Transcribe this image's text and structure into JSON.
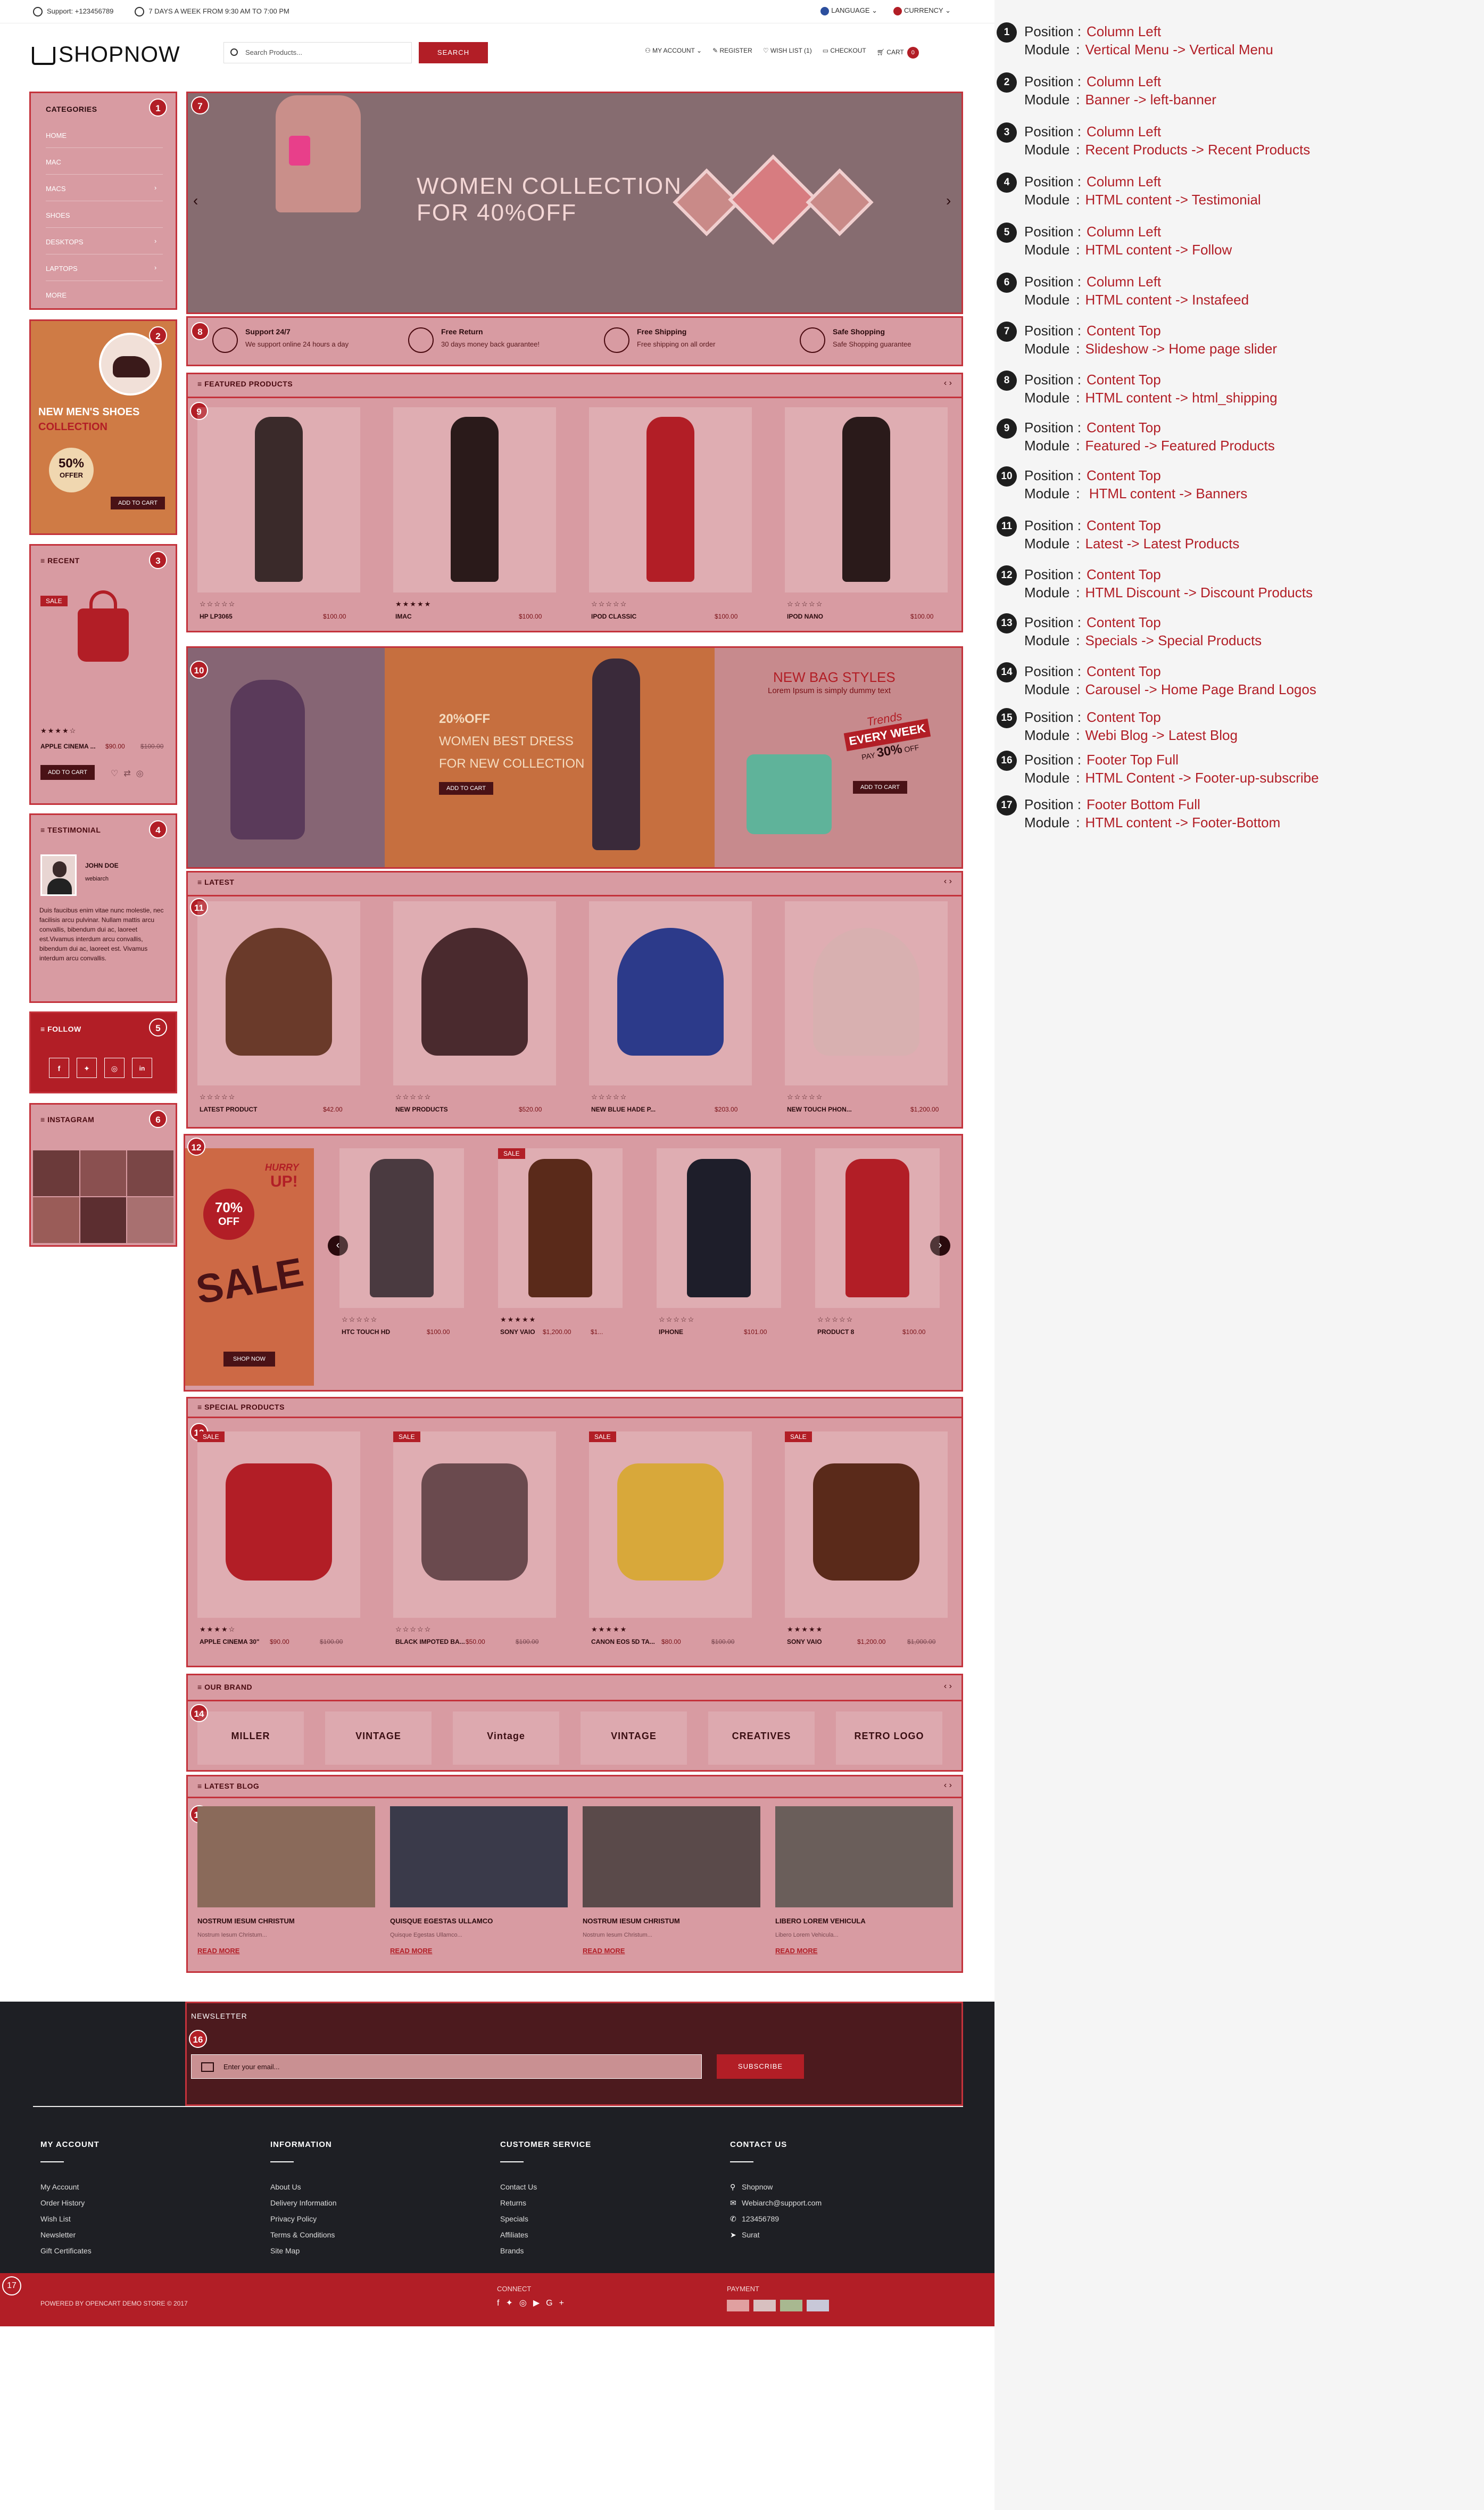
{
  "topbar": {
    "support": "Support: +123456789",
    "hours": "7 DAYS A WEEK FROM 9:30 AM TO 7:00 PM",
    "language": "LANGUAGE",
    "currency": "CURRENCY"
  },
  "header": {
    "logo": "SHOPNOW",
    "search_placeholder": "Search Products...",
    "search_button": "SEARCH",
    "my_account": "MY ACCOUNT",
    "register": "REGISTER",
    "wishlist": "WISH LIST (1)",
    "checkout": "CHECKOUT",
    "cart": "CART",
    "cart_count": "0"
  },
  "sidebar": {
    "categories_title": "CATEGORIES",
    "categories": [
      "HOME",
      "MAC",
      "MACS",
      "SHOES",
      "DESKTOPS",
      "LAPTOPS",
      "MORE"
    ],
    "banner": {
      "title": "NEW MEN'S SHOES",
      "subtitle": "COLLECTION",
      "offer": "50%",
      "offer_sub": "OFFER",
      "button": "ADD TO CART"
    },
    "recent": {
      "title": "RECENT",
      "sale": "SALE",
      "name": "APPLE CINEMA ...",
      "price": "$90.00",
      "old": "$100.00",
      "button": "ADD TO CART"
    },
    "testimonial": {
      "title": "TESTIMONIAL",
      "name": "JOHN DOE",
      "handle": "webiarch",
      "text": "Duis faucibus enim vitae nunc molestie, nec facilisis arcu pulvinar. Nullam mattis arcu convallis, bibendum dui ac, laoreet est.Vivamus interdum arcu convallis, bibendum dui ac, laoreet est. Vivamus interdum arcu convallis."
    },
    "follow": {
      "title": "FOLLOW",
      "icons": [
        "facebook-icon",
        "twitter-icon",
        "instagram-icon",
        "linkedin-icon"
      ]
    },
    "instagram": {
      "title": "INSTAGRAM"
    }
  },
  "slider": {
    "title": "WOMEN COLLECTION",
    "subtitle": "FOR 40%OFF"
  },
  "shipping": [
    {
      "title": "Support 24/7",
      "text": "We support online 24 hours a day"
    },
    {
      "title": "Free Return",
      "text": "30 days money back guarantee!"
    },
    {
      "title": "Free Shipping",
      "text": "Free shipping on all order"
    },
    {
      "title": "Safe Shopping",
      "text": "Safe Shopping guarantee"
    }
  ],
  "featured": {
    "title": "FEATURED PRODUCTS",
    "items": [
      {
        "name": "HP LP3065",
        "price": "$100.00",
        "stars": "☆☆☆☆☆"
      },
      {
        "name": "IMAC",
        "price": "$100.00",
        "stars": "★★★★★"
      },
      {
        "name": "IPOD CLASSIC",
        "price": "$100.00",
        "stars": "☆☆☆☆☆"
      },
      {
        "name": "IPOD NANO",
        "price": "$100.00",
        "stars": "☆☆☆☆☆"
      }
    ]
  },
  "banners": {
    "b1_line1": "20%OFF",
    "b1_line2": "WOMEN BEST DRESS",
    "b1_line3": "FOR NEW COLLECTION",
    "b1_button": "ADD TO CART",
    "b2_title": "NEW BAG STYLES",
    "b2_sub": "Lorem Ipsum is simply dummy text",
    "b2_tag1": "Trends",
    "b2_tag2": "EVERY WEEK",
    "b2_tag3": "PAY",
    "b2_tag4": "30%",
    "b2_tag5": "OFF",
    "b2_button": "ADD TO CART"
  },
  "latest": {
    "title": "LATEST",
    "items": [
      {
        "name": "LATEST PRODUCT",
        "price": "$42.00"
      },
      {
        "name": "NEW PRODUCTS",
        "price": "$520.00"
      },
      {
        "name": "NEW BLUE HADE P...",
        "price": "$203.00"
      },
      {
        "name": "NEW TOUCH PHON...",
        "price": "$1,200.00"
      }
    ]
  },
  "discount": {
    "hurry": "HURRY",
    "up": "UP!",
    "off": "70%",
    "off_sub": "OFF",
    "sale": "SALE",
    "shop_now": "SHOP NOW",
    "items": [
      {
        "name": "HTC TOUCH HD",
        "price": "$100.00",
        "stars": "☆☆☆☆☆"
      },
      {
        "name": "SONY VAIO",
        "price": "$1,200.00",
        "extra": "$1...",
        "stars": "★★★★★",
        "sale": "SALE"
      },
      {
        "name": "IPHONE",
        "price": "$101.00",
        "stars": "☆☆☆☆☆"
      },
      {
        "name": "PRODUCT 8",
        "price": "$100.00",
        "stars": "☆☆☆☆☆"
      }
    ]
  },
  "special": {
    "title": "SPECIAL PRODUCTS",
    "items": [
      {
        "name": "APPLE CINEMA 30\"",
        "price": "$90.00",
        "old": "$100.00",
        "stars": "★★★★☆"
      },
      {
        "name": "BLACK IMPOTED BA...",
        "price": "$50.00",
        "old": "$100.00",
        "stars": "☆☆☆☆☆"
      },
      {
        "name": "CANON EOS 5D TA...",
        "price": "$80.00",
        "old": "$100.00",
        "stars": "★★★★★"
      },
      {
        "name": "SONY VAIO",
        "price": "$1,200.00",
        "old": "$1,000.00",
        "stars": "★★★★★"
      }
    ],
    "sale": "SALE"
  },
  "brands": {
    "title": "OUR BRAND",
    "items": [
      "MILLER",
      "VINTAGE",
      "Vintage",
      "VINTAGE",
      "CREATIVES",
      "RETRO LOGO"
    ]
  },
  "blog": {
    "title": "LATEST BLOG",
    "items": [
      {
        "title": "NOSTRUM IESUM CHRISTUM",
        "text": "Nostrum Iesum Christum..."
      },
      {
        "title": "QUISQUE EGESTAS ULLAMCO",
        "text": "Quisque Egestas Ullamco..."
      },
      {
        "title": "NOSTRUM IESUM CHRISTUM",
        "text": "Nostrum Iesum Christum..."
      },
      {
        "title": "LIBERO LOREM VEHICULA",
        "text": "Libero Lorem Vehicula..."
      }
    ],
    "read_more": "READ MORE"
  },
  "newsletter": {
    "title": "NEWSLETTER",
    "placeholder": "Enter your email...",
    "button": "SUBSCRIBE"
  },
  "footer": {
    "cols": [
      {
        "title": "MY ACCOUNT",
        "items": [
          "My Account",
          "Order History",
          "Wish List",
          "Newsletter",
          "Gift Certificates"
        ]
      },
      {
        "title": "INFORMATION",
        "items": [
          "About Us",
          "Delivery Information",
          "Privacy Policy",
          "Terms & Conditions",
          "Site Map"
        ]
      },
      {
        "title": "CUSTOMER SERVICE",
        "items": [
          "Contact Us",
          "Returns",
          "Specials",
          "Affiliates",
          "Brands"
        ]
      },
      {
        "title": "CONTACT US",
        "items": [
          "Shopnow",
          "Webiarch@support.com",
          "123456789",
          "Surat"
        ]
      }
    ],
    "powered": "POWERED BY OPENCART DEMO STORE © 2017",
    "connect": "CONNECT",
    "payment": "PAYMENT"
  },
  "legend": {
    "position_label": "Position :",
    "module_label": "Module",
    "rows": [
      {
        "n": "1",
        "position": "Column  Left",
        "module": "Vertical Menu -> Vertical Menu"
      },
      {
        "n": "2",
        "position": "Column  Left",
        "module": "Banner  -> left-banner"
      },
      {
        "n": "3",
        "position": "Column  Left",
        "module": "Recent Products -> Recent Products"
      },
      {
        "n": "4",
        "position": "Column  Left",
        "module": "HTML content -> Testimonial"
      },
      {
        "n": "5",
        "position": "Column  Left",
        "module": "HTML content -> Follow"
      },
      {
        "n": "6",
        "position": "Column  Left",
        "module": "HTML content -> Instafeed"
      },
      {
        "n": "7",
        "position": "Content Top",
        "module": "Slideshow -> Home page slider"
      },
      {
        "n": "8",
        "position": "Content Top",
        "module": "HTML content -> html_shipping"
      },
      {
        "n": "9",
        "position": "Content Top",
        "module": "Featured -> Featured Products"
      },
      {
        "n": "10",
        "position": "Content Top",
        "module": " HTML content ->  Banners"
      },
      {
        "n": "11",
        "position": "Content Top",
        "module": "Latest -> Latest Products"
      },
      {
        "n": "12",
        "position": "Content Top",
        "module": "HTML Discount -> Discount Products"
      },
      {
        "n": "13",
        "position": "Content Top",
        "module": "Specials -> Special Products"
      },
      {
        "n": "14",
        "position": "Content Top",
        "module": "Carousel -> Home Page Brand Logos"
      },
      {
        "n": "15",
        "position": "Content Top",
        "module": "Webi Blog -> Latest Blog"
      },
      {
        "n": "16",
        "position": "Footer Top Full",
        "module": "HTML Content -> Footer-up-subscribe"
      },
      {
        "n": "17",
        "position": "Footer Bottom Full",
        "module": "HTML content -> Footer-Bottom"
      }
    ]
  }
}
